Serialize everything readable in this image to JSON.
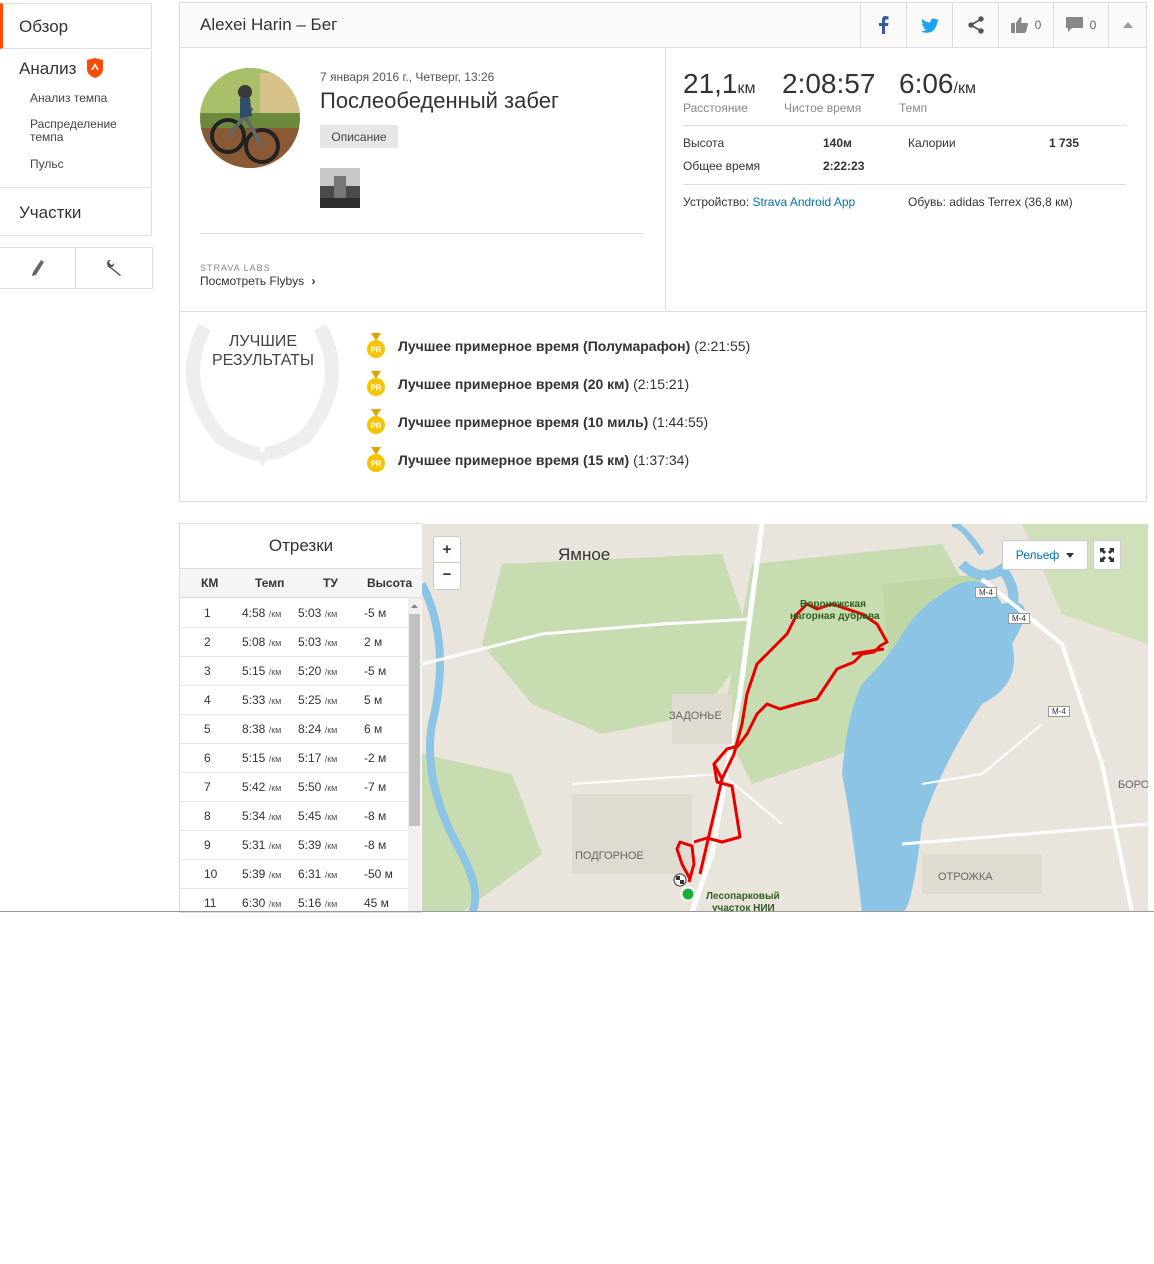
{
  "sidebar": {
    "overview": "Обзор",
    "analysis": "Анализ",
    "analysis_items": [
      "Анализ темпа",
      "Распределение темпа",
      "Пульс"
    ],
    "segments": "Участки",
    "tools": [
      "pencil-icon",
      "wrench-icon"
    ]
  },
  "header": {
    "title": "Alexei Harin – Бег",
    "kudos_count": "0",
    "comments_count": "0",
    "share_buttons": [
      "facebook-icon",
      "twitter-icon",
      "share-icon"
    ]
  },
  "activity": {
    "date": "7 января 2016 г., Четверг, 13:26",
    "title": "Послеобеденный забег",
    "description_button": "Описание",
    "labs": "STRAVA LABS",
    "flyby_link": "Посмотреть Flybys"
  },
  "stats": {
    "distance_value": "21,1",
    "distance_unit": "км",
    "distance_label": "Расстояние",
    "moving_time_value": "2:08:57",
    "moving_time_label": "Чистое время",
    "pace_value": "6:06",
    "pace_unit": "/км",
    "pace_label": "Темп",
    "elevation_label": "Высота",
    "elevation_value": "140м",
    "calories_label": "Калории",
    "calories_value": "1 735",
    "elapsed_label": "Общее время",
    "elapsed_value": "2:22:23",
    "device_label": "Устройство:",
    "device_value": "Strava Android App",
    "shoes_label": "Обувь:",
    "shoes_value": "adidas Terrex (36,8 км)"
  },
  "achievements": {
    "title_line1": "ЛУЧШИЕ",
    "title_line2": "РЕЗУЛЬТАТЫ",
    "medal_label": "PR",
    "items": [
      {
        "name": "Лучшее примерное время (Полумарафон)",
        "time": "(2:21:55)"
      },
      {
        "name": "Лучшее примерное время (20 км)",
        "time": "(2:15:21)"
      },
      {
        "name": "Лучшее примерное время (10 миль)",
        "time": "(1:44:55)"
      },
      {
        "name": "Лучшее примерное время (15 км)",
        "time": "(1:37:34)"
      }
    ]
  },
  "splits": {
    "title": "Отрезки",
    "headers": [
      "КМ",
      "Темп",
      "ТУ",
      "Высота"
    ],
    "pace_unit": "/км",
    "rows": [
      {
        "km": "1",
        "pace": "4:58",
        "gap": "5:03",
        "elev": "-5 м"
      },
      {
        "km": "2",
        "pace": "5:08",
        "gap": "5:03",
        "elev": "2 м"
      },
      {
        "km": "3",
        "pace": "5:15",
        "gap": "5:20",
        "elev": "-5 м"
      },
      {
        "km": "4",
        "pace": "5:33",
        "gap": "5:25",
        "elev": "5 м"
      },
      {
        "km": "5",
        "pace": "8:38",
        "gap": "8:24",
        "elev": "6 м"
      },
      {
        "km": "6",
        "pace": "5:15",
        "gap": "5:17",
        "elev": "-2 м"
      },
      {
        "km": "7",
        "pace": "5:42",
        "gap": "5:50",
        "elev": "-7 м"
      },
      {
        "km": "8",
        "pace": "5:34",
        "gap": "5:45",
        "elev": "-8 м"
      },
      {
        "km": "9",
        "pace": "5:31",
        "gap": "5:39",
        "elev": "-8 м"
      },
      {
        "km": "10",
        "pace": "5:39",
        "gap": "6:31",
        "elev": "-50 м"
      },
      {
        "km": "11",
        "pace": "6:30",
        "gap": "5:16",
        "elev": "45 м"
      }
    ]
  },
  "map": {
    "zoom_in": "+",
    "zoom_out": "−",
    "layer_button": "Рельеф",
    "labels": {
      "yamnoe": "Ямное",
      "dubrava1": "Воронежская",
      "dubrava2": "нагорная дубрава",
      "zadonye": "ЗАДОНЬЕ",
      "podgornoe": "ПОДГОРНОЕ",
      "otrozhka": "ОТРОЖКА",
      "boro": "БОРО",
      "forest1": "Лесопарковый",
      "forest2": "участок НИИ",
      "m4": "М-4"
    },
    "colors": {
      "route": "#e60000",
      "water": "#8cc4e6",
      "forest": "#c7dcb0",
      "land": "#e9e5dc"
    }
  },
  "colors": {
    "accent": "#fc4c02",
    "link": "#0073a8",
    "medal": "#f5c400"
  }
}
